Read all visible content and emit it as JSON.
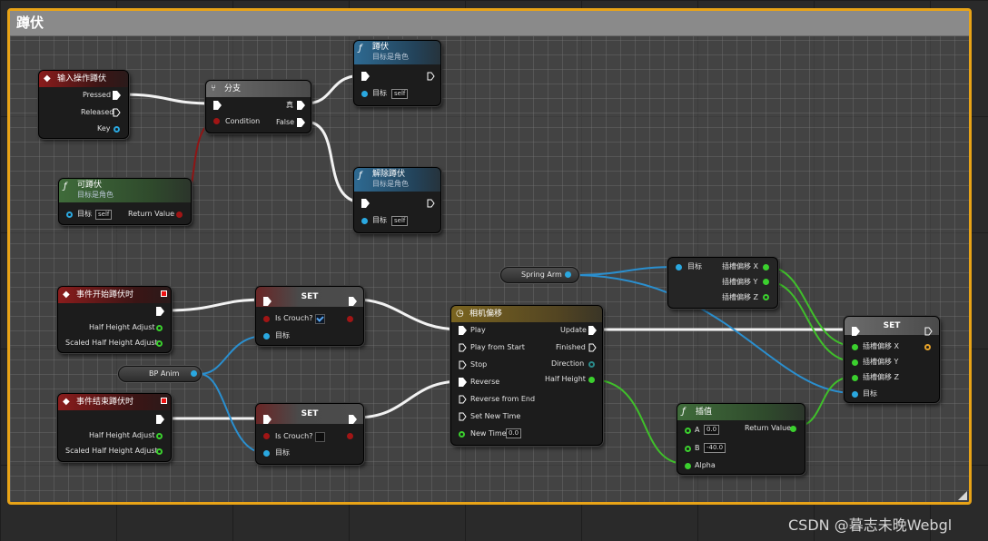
{
  "comment": {
    "title": "蹲伏"
  },
  "nodes": {
    "input_crouch": {
      "title": "输入操作蹲伏",
      "pressed": "Pressed",
      "released": "Released",
      "key": "Key"
    },
    "branch": {
      "title": "分支",
      "true_label": "真",
      "false_label": "False",
      "condition": "Condition"
    },
    "crouch": {
      "title": "蹲伏",
      "subtitle": "目标是角色",
      "target": "目标",
      "self": "self"
    },
    "uncrouch": {
      "title": "解除蹲伏",
      "subtitle": "目标是角色",
      "target": "目标",
      "self": "self"
    },
    "can_crouch": {
      "title": "可蹲伏",
      "subtitle": "目标是角色",
      "target": "目标",
      "self": "self",
      "return_value": "Return Value"
    },
    "on_start_crouch": {
      "title": "事件开始蹲伏时",
      "half_height": "Half Height Adjust",
      "scaled_half_height": "Scaled Half Height Adjust"
    },
    "on_end_crouch": {
      "title": "事件结束蹲伏时",
      "half_height": "Half Height Adjust",
      "scaled_half_height": "Scaled Half Height Adjust"
    },
    "set1": {
      "title": "SET",
      "is_crouch": "Is Crouch?",
      "target": "目标",
      "checked": true
    },
    "set2": {
      "title": "SET",
      "is_crouch": "Is Crouch?",
      "target": "目标",
      "checked": false
    },
    "bp_anim": {
      "label": "BP Anim"
    },
    "spring_arm": {
      "label": "Spring Arm"
    },
    "break_vec": {
      "target": "目标",
      "x": "插槽偏移 X",
      "y": "插槽偏移 Y",
      "z": "插槽偏移 Z"
    },
    "timeline": {
      "title": "相机偏移",
      "play": "Play",
      "play_from_start": "Play from Start",
      "stop": "Stop",
      "reverse": "Reverse",
      "reverse_from_end": "Reverse from End",
      "set_new_time": "Set New Time",
      "new_time": "New Time",
      "new_time_value": "0.0",
      "update": "Update",
      "finished": "Finished",
      "direction": "Direction",
      "half_height": "Half Height"
    },
    "lerp": {
      "title": "插值",
      "a": "A",
      "a_value": "0.0",
      "b": "B",
      "b_value": "-40.0",
      "alpha": "Alpha",
      "return_value": "Return Value"
    },
    "set3": {
      "title": "SET",
      "x": "插槽偏移 X",
      "y": "插槽偏移 Y",
      "z": "插槽偏移 Z",
      "target": "目标"
    }
  },
  "colors": {
    "comment_border": "#e8a317",
    "exec": "#ffffff",
    "object": "#2aa8e0",
    "float": "#3bd02e",
    "bool": "#a11515"
  },
  "watermark": "CSDN @暮志未晚Webgl"
}
